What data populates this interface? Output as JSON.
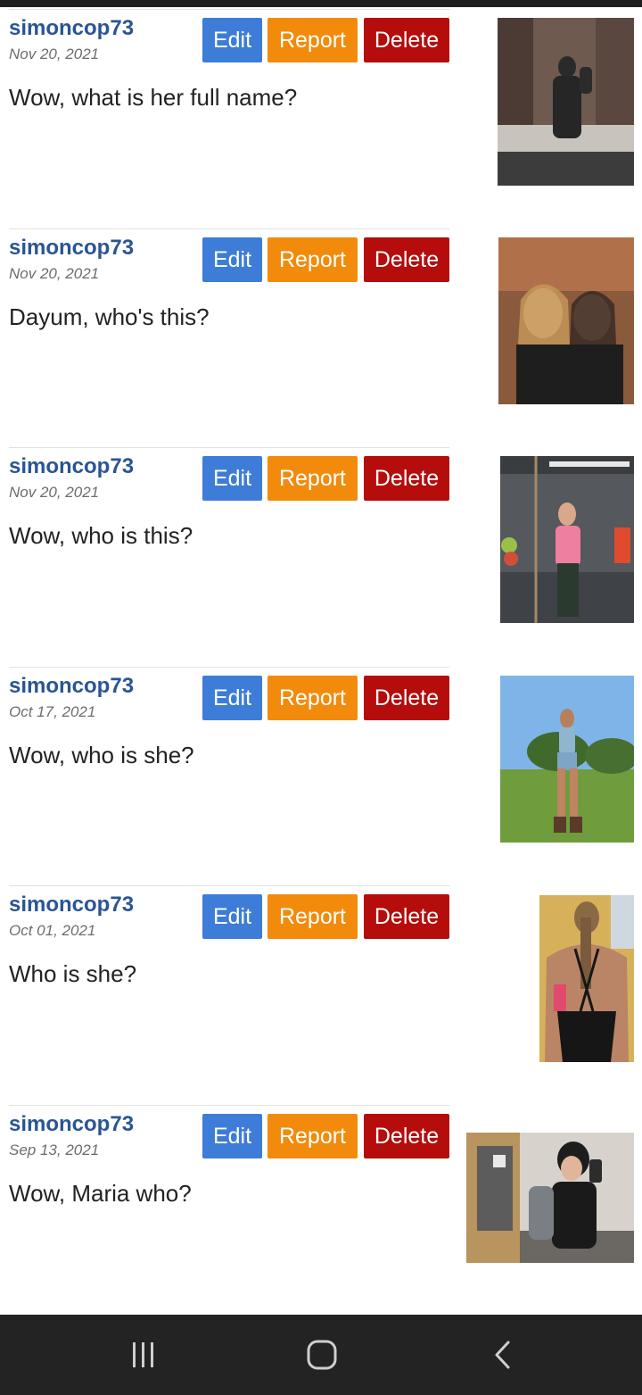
{
  "buttons": {
    "edit": "Edit",
    "report": "Report",
    "delete": "Delete"
  },
  "posts": [
    {
      "user": "simoncop73",
      "date": "Nov 20, 2021",
      "text": "Wow, what is her full name?"
    },
    {
      "user": "simoncop73",
      "date": "Nov 20, 2021",
      "text": "Dayum, who's this?"
    },
    {
      "user": "simoncop73",
      "date": "Nov 20, 2021",
      "text": "Wow, who is this?"
    },
    {
      "user": "simoncop73",
      "date": "Oct 17, 2021",
      "text": "Wow, who is she?"
    },
    {
      "user": "simoncop73",
      "date": "Oct 01, 2021",
      "text": "Who is she?"
    },
    {
      "user": "simoncop73",
      "date": "Sep 13, 2021",
      "text": "Wow, Maria who?"
    }
  ],
  "nav": {
    "recents_icon": "recents-icon",
    "home_icon": "home-icon",
    "back_icon": "back-icon"
  },
  "colors": {
    "edit": "#3d7dd8",
    "report": "#f28b0c",
    "delete": "#b50c0c",
    "username": "#2a5594"
  }
}
